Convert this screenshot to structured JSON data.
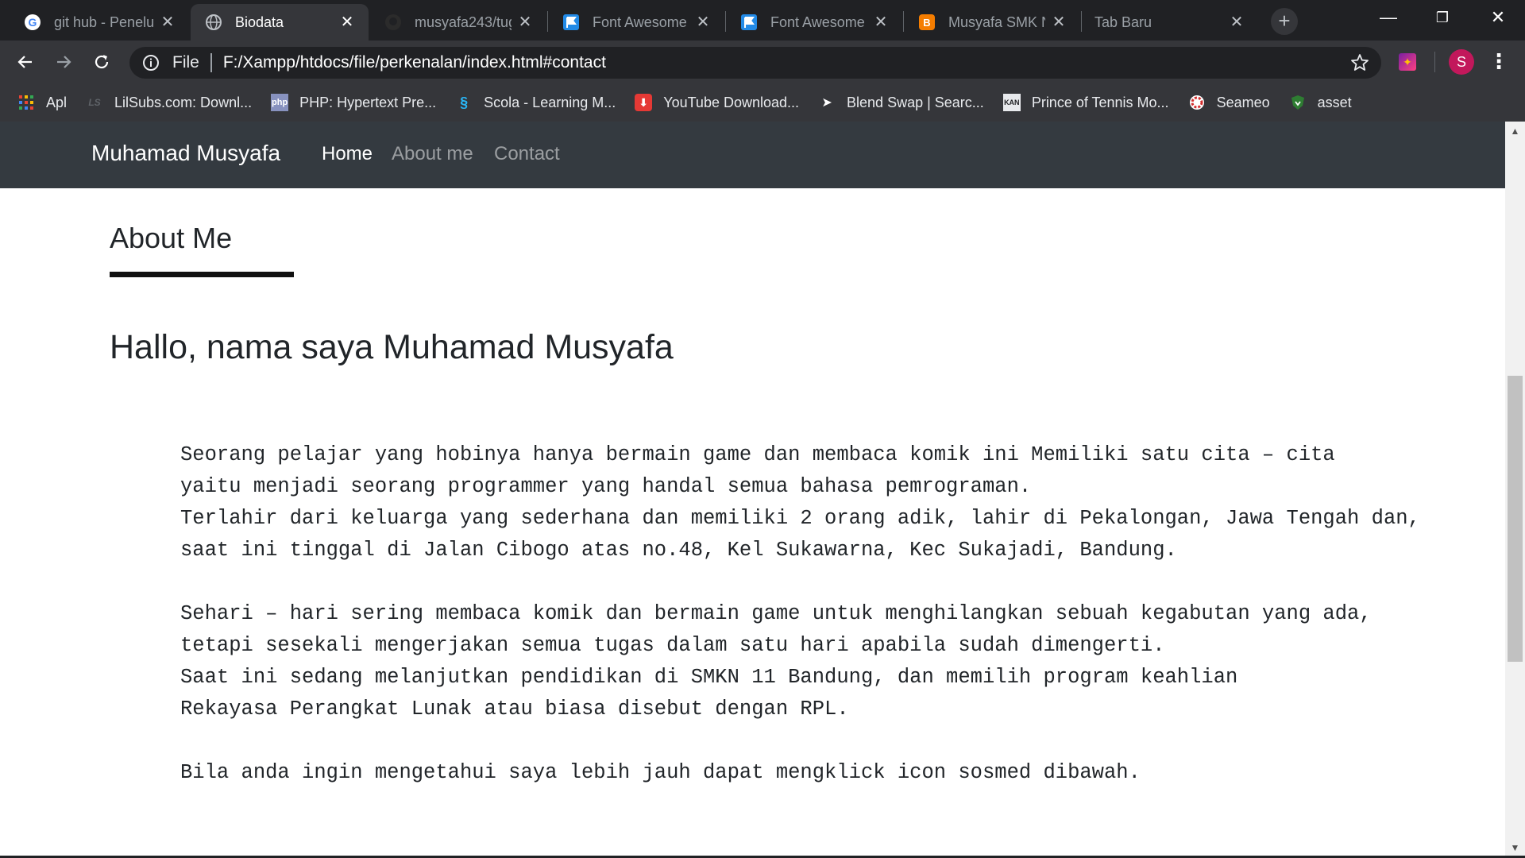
{
  "browser": {
    "tabs": [
      {
        "title": "git hub - Penelu",
        "favicon": "google-icon",
        "active": false
      },
      {
        "title": "Biodata",
        "favicon": "globe-icon",
        "active": true
      },
      {
        "title": "musyafa243/tug",
        "favicon": "github-icon",
        "active": false
      },
      {
        "title": "Font Awesome",
        "favicon": "font-awesome-flag-icon",
        "active": false
      },
      {
        "title": "Font Awesome",
        "favicon": "font-awesome-flag-icon",
        "active": false
      },
      {
        "title": "Musyafa SMK N",
        "favicon": "blogger-icon",
        "active": false
      },
      {
        "title": "Tab Baru",
        "favicon": "none",
        "active": false
      }
    ],
    "new_tab_glyph": "+",
    "window_controls": {
      "minimize": "—",
      "restore": "❐",
      "close": "✕"
    },
    "omnibox": {
      "scheme_label": "File",
      "url": "F:/Xampp/htdocs/file/perkenalan/index.html#contact"
    },
    "profile_initial": "S",
    "bookmarks": [
      {
        "label": "Apl",
        "icon": "apps-grid-icon"
      },
      {
        "label": "LilSubs.com: Downl...",
        "icon": "lilsubs-icon"
      },
      {
        "label": "PHP: Hypertext Pre...",
        "icon": "php-icon"
      },
      {
        "label": "Scola - Learning M...",
        "icon": "scola-icon"
      },
      {
        "label": "YouTube Download...",
        "icon": "download-icon"
      },
      {
        "label": "Blend Swap | Searc...",
        "icon": "blendswap-icon"
      },
      {
        "label": "Prince of Tennis Mo...",
        "icon": "kan-icon"
      },
      {
        "label": "Seameo",
        "icon": "seameo-icon"
      },
      {
        "label": "asset",
        "icon": "asset-shield-icon"
      }
    ]
  },
  "site": {
    "brand": "Muhamad Musyafa",
    "nav": [
      {
        "label": "Home",
        "active": true
      },
      {
        "label": "About me",
        "active": false
      },
      {
        "label": "Contact",
        "active": false
      }
    ],
    "about_title": "About Me",
    "greeting": "Hallo, nama saya Muhamad Musyafa",
    "bio": {
      "p1": [
        "Seorang pelajar yang hobinya hanya bermain game dan membaca komik ini Memiliki satu cita – cita",
        "yaitu menjadi seorang programmer yang handal semua bahasa pemrograman.",
        "Terlahir dari keluarga yang sederhana dan memiliki 2 orang adik, lahir di Pekalongan, Jawa Tengah dan,",
        "saat ini tinggal di Jalan Cibogo atas no.48, Kel Sukawarna, Kec Sukajadi, Bandung."
      ],
      "p2": [
        "Sehari – hari sering membaca komik dan bermain game untuk menghilangkan sebuah kegabutan yang ada,",
        "tetapi sesekali mengerjakan semua tugas dalam satu hari apabila sudah dimengerti.",
        "Saat ini sedang melanjutkan pendidikan di SMKN 11 Bandung, dan memilih program keahlian",
        "Rekayasa Perangkat Lunak atau biasa disebut dengan RPL."
      ],
      "p3": [
        "Bila anda ingin mengetahui saya lebih jauh dapat mengklick icon sosmed dibawah."
      ]
    }
  },
  "colors": {
    "tabstrip": "#202124",
    "toolbar": "#35363a",
    "site_nav": "#343a40",
    "text": "#212529"
  }
}
